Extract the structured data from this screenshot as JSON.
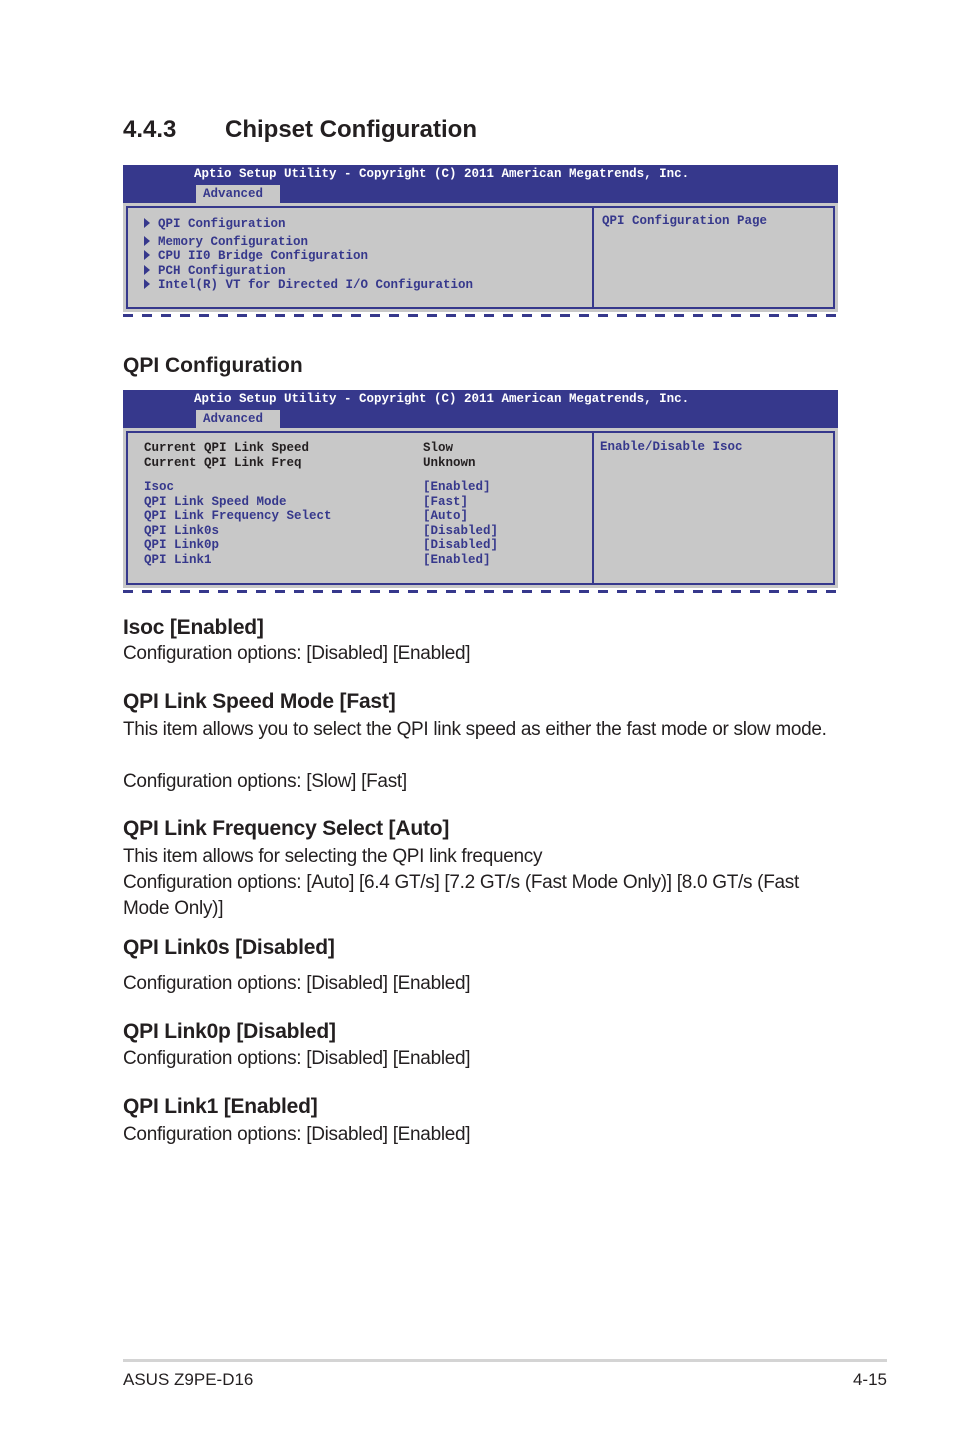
{
  "section": {
    "number": "4.4.3",
    "title": "Chipset Configuration"
  },
  "bios_header": {
    "title": "Aptio Setup Utility - Copyright (C) 2011 American Megatrends, Inc.",
    "tab": "Advanced"
  },
  "screen1": {
    "menu_items": [
      {
        "label": "QPI Configuration",
        "icon": "submenu-arrow-icon"
      },
      {
        "label": "Memory Configuration",
        "icon": "submenu-arrow-icon"
      },
      {
        "label": "CPU II0 Bridge Configuration",
        "icon": "submenu-arrow-icon"
      },
      {
        "label": "PCH Configuration",
        "icon": "submenu-arrow-icon"
      },
      {
        "label": "Intel(R) VT for Directed I/O Configuration",
        "icon": "submenu-arrow-icon"
      }
    ],
    "help": "QPI Configuration Page"
  },
  "subsection_title": "QPI Configuration",
  "screen2": {
    "info": [
      {
        "label": "Current QPI Link Speed",
        "value": "Slow"
      },
      {
        "label": "Current QPI Link Freq",
        "value": "Unknown"
      }
    ],
    "settings": [
      {
        "label": "Isoc",
        "value": "[Enabled]"
      },
      {
        "label": "QPI Link Speed Mode",
        "value": "[Fast]"
      },
      {
        "label": "QPI Link Frequency Select",
        "value": "[Auto]"
      },
      {
        "label": "QPI Link0s",
        "value": "[Disabled]"
      },
      {
        "label": "QPI Link0p",
        "value": "[Disabled]"
      },
      {
        "label": "QPI Link1",
        "value": "[Enabled]"
      }
    ],
    "help": "Enable/Disable Isoc"
  },
  "descriptions": [
    {
      "title": "Isoc [Enabled]",
      "lines": [
        "Configuration options: [Disabled] [Enabled]"
      ]
    },
    {
      "title": "QPI Link Speed Mode [Fast]",
      "lines": [
        "This item allows you to select the QPI link speed as either the fast mode or slow mode.",
        "Configuration options: [Slow] [Fast]"
      ]
    },
    {
      "title": "QPI Link Frequency Select [Auto]",
      "lines": [
        "This item allows for selecting the QPI link frequency",
        "Configuration options: [Auto] [6.4 GT/s] [7.2 GT/s (Fast Mode Only)] [8.0 GT/s (Fast Mode Only)]"
      ]
    },
    {
      "title": "QPI Link0s [Disabled]",
      "lines": [
        "Configuration options: [Disabled] [Enabled]"
      ]
    },
    {
      "title": "QPI Link0p [Disabled]",
      "lines": [
        "Configuration options: [Disabled] [Enabled]"
      ]
    },
    {
      "title": "QPI Link1 [Enabled]",
      "lines": [
        "Configuration options: [Disabled] [Enabled]"
      ]
    }
  ],
  "footer": {
    "product": "ASUS Z9PE-D16",
    "page": "4-15"
  }
}
